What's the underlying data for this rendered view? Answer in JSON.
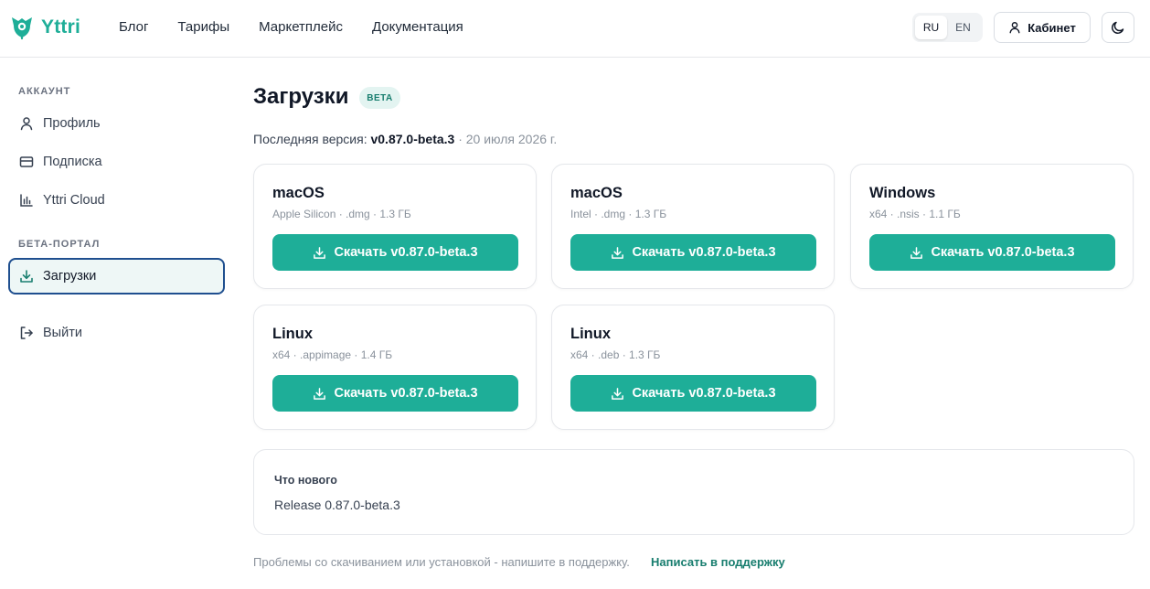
{
  "brand": {
    "name": "Yttri",
    "accent": "#1eae98",
    "logo_icon": "shield-leaf-icon"
  },
  "nav": {
    "items": [
      "Блог",
      "Тарифы",
      "Маркетплейс",
      "Документация"
    ]
  },
  "header": {
    "lang": {
      "options": [
        "RU",
        "EN"
      ],
      "selected": "RU"
    },
    "cabinet_label": "Кабинет",
    "cabinet_icon": "user-icon",
    "theme_icon": "moon-icon"
  },
  "sidebar": {
    "account_heading": "АККАУНТ",
    "account_items": [
      {
        "label": "Профиль",
        "icon": "user-icon"
      },
      {
        "label": "Подписка",
        "icon": "credit-card-icon"
      },
      {
        "label": "Yttri Cloud",
        "icon": "bar-chart-icon"
      }
    ],
    "beta_heading": "БЕТА-ПОРТАЛ",
    "beta_items": [
      {
        "label": "Загрузки",
        "icon": "download-icon",
        "active": true
      }
    ],
    "logout_label": "Выйти",
    "logout_icon": "logout-icon"
  },
  "main": {
    "title": "Загрузки",
    "badge": "BETA",
    "latest_label": "Последняя версия:",
    "latest_version": "v0.87.0-beta.3",
    "latest_date": "· 20 июля 2026 г.",
    "downloads": [
      {
        "os": "macOS",
        "meta": "Apple Silicon · .dmg · 1.3 ГБ",
        "button": "Скачать v0.87.0-beta.3"
      },
      {
        "os": "macOS",
        "meta": "Intel · .dmg · 1.3 ГБ",
        "button": "Скачать v0.87.0-beta.3"
      },
      {
        "os": "Windows",
        "meta": "x64 · .nsis · 1.1 ГБ",
        "button": "Скачать v0.87.0-beta.3"
      },
      {
        "os": "Linux",
        "meta": "x64 · .appimage · 1.4 ГБ",
        "button": "Скачать v0.87.0-beta.3"
      },
      {
        "os": "Linux",
        "meta": "x64 · .deb · 1.3 ГБ",
        "button": "Скачать v0.87.0-beta.3"
      }
    ],
    "whats_new": {
      "title": "Что нового",
      "body": "Release 0.87.0-beta.3"
    },
    "footer_note": "Проблемы со скачиванием или установкой - напишите в поддержку.",
    "support_link": "Написать в поддержку"
  }
}
